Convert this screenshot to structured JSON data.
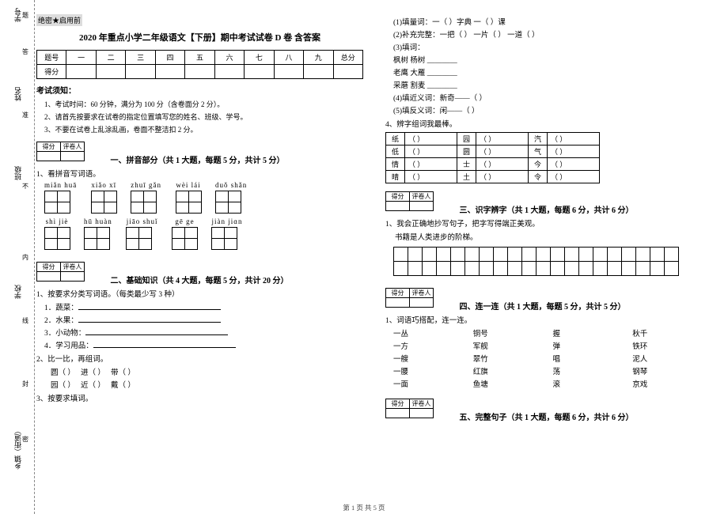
{
  "binding": {
    "l1": "学号",
    "l2": "姓名",
    "l3": "班级",
    "l4": "学校",
    "l5": "乡镇（街道）",
    "side_note_chars": [
      "答",
      "准",
      "不",
      "内",
      "线",
      "封",
      "密"
    ],
    "tick": "题"
  },
  "secret_label": "绝密★启用前",
  "title": "2020 年重点小学二年级语文【下册】期中考试试卷 D 卷  含答案",
  "score_table": {
    "row1": [
      "题号",
      "一",
      "二",
      "三",
      "四",
      "五",
      "六",
      "七",
      "八",
      "九",
      "总分"
    ],
    "row2_label": "得分"
  },
  "exam_rules_heading": "考试须知：",
  "exam_rules": [
    "1、考试时间：60 分钟，满分为 100 分（含卷面分 2 分）。",
    "2、请首先按要求在试卷的指定位置填写您的姓名、班级、学号。",
    "3、不要在试卷上乱涂乱画，卷面不整洁扣 2 分。"
  ],
  "scorebox_headers": [
    "得分",
    "评卷人"
  ],
  "sections": {
    "s1": {
      "title": "一、拼音部分（共 1 大题，每题 5 分，共计 5 分）",
      "q1": "1、看拼音写词语。"
    },
    "s2": {
      "title": "二、基础知识（共 4 大题，每题 5 分，共计 20 分）",
      "q1": "1、按要求分类写词语。（每类最少写 3 种）",
      "q1items": [
        "1．蔬菜：",
        "2．水果：",
        "3．小动物：",
        "4．学习用品："
      ],
      "q2": "2、比一比，再组词。",
      "q2a": [
        "圆（        ）",
        "进（        ）",
        "带（        ）"
      ],
      "q2b": [
        "园（        ）",
        "近（        ）",
        "戴（        ）"
      ],
      "q3": "3、按要求填词。",
      "q3_1": "(1)填量词：一（        ）字典    一（        ）课",
      "q3_2": "(2)补充完整：一把（        ）  一片（        ）  一道（        ）",
      "q3_3": "(3)填词：",
      "q3_3a": "枫树    杨树    ________",
      "q3_3b": "老鹰    大雁    ________",
      "q3_3c": "采蘑    割麦    ________",
      "q3_4": "(4)填近义词：新奇——（        ）",
      "q3_5": "(5)填反义词：闲——（        ）",
      "q4": "4、辨字组词我最棒。"
    },
    "s3": {
      "title": "三、识字辨字（共 1 大题，每题 6 分，共计 6 分）",
      "q1": "1、我会正确地抄写句子，把字写得端正美观。",
      "q1_text": "书籍是人类进步的阶梯。"
    },
    "s4": {
      "title": "四、连一连（共 1 大题，每题 5 分，共计 5 分）",
      "q1": "1、词语巧搭配，连一连。",
      "rows": [
        [
          "一丛",
          "铜号",
          "握",
          "秋千"
        ],
        [
          "一方",
          "军舰",
          "弹",
          "铁环"
        ],
        [
          "一艘",
          "翠竹",
          "唱",
          "泥人"
        ],
        [
          "一腰",
          "红旗",
          "荡",
          "钢琴"
        ],
        [
          "一面",
          "鱼塘",
          "滚",
          "京戏"
        ]
      ]
    },
    "s5": {
      "title": "五、完整句子（共 1 大题，每题 6 分，共计 6 分）"
    }
  },
  "pinyin": {
    "row1": [
      "miǎn huā",
      "xiǎo xī",
      "zhuī gǎn",
      "wèi lái",
      "duǒ shǎn"
    ],
    "row2": [
      "shì jiè",
      "hū huàn",
      "jiāo shuǐ",
      "gē ge",
      "jiàn jiɑn"
    ]
  },
  "char_pairs": {
    "r1": [
      "纸",
      "园",
      "汽"
    ],
    "r2": [
      "低",
      "圆",
      "气"
    ],
    "r3": [
      "情",
      "士",
      "今"
    ],
    "r4": [
      "晴",
      "土",
      "令"
    ]
  },
  "footer": "第 1 页 共 5 页"
}
